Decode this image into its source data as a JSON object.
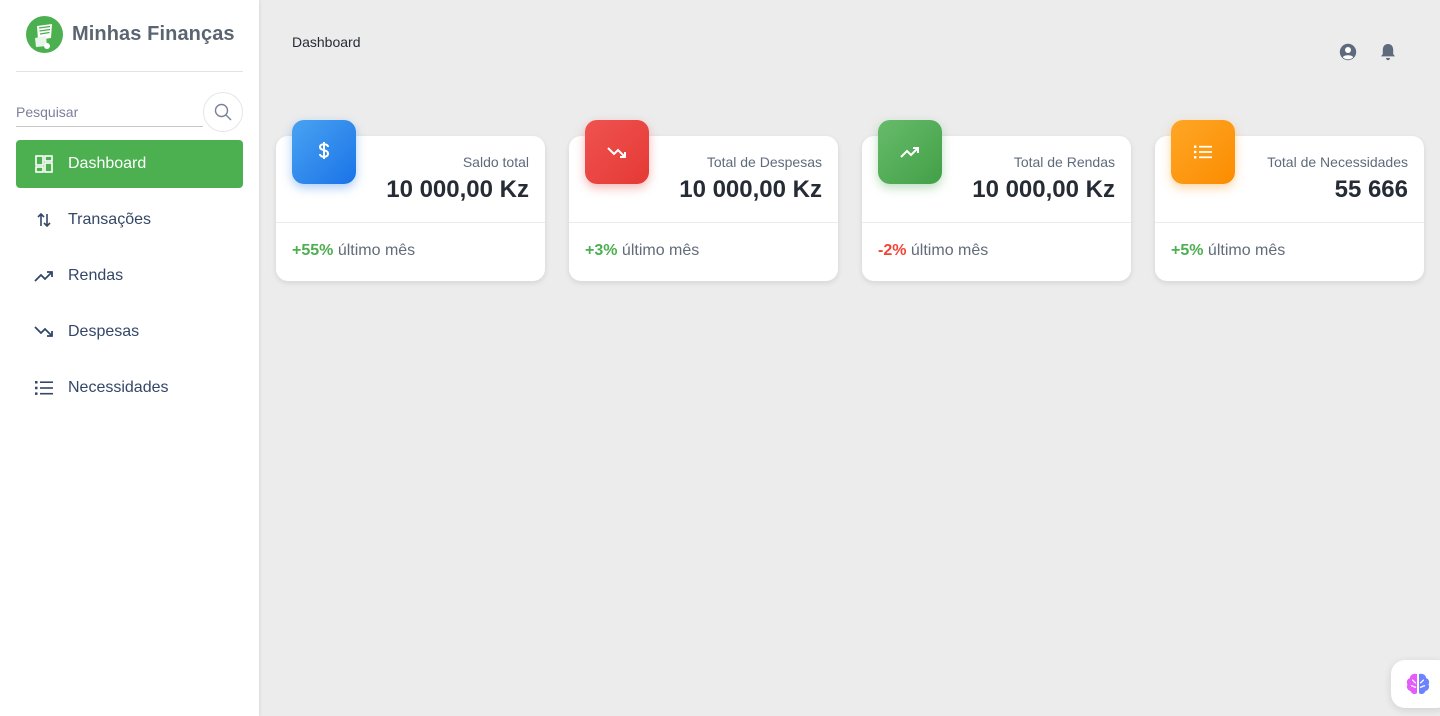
{
  "app": {
    "title": "Minhas Finanças"
  },
  "search": {
    "placeholder": "Pesquisar"
  },
  "nav": {
    "items": [
      {
        "label": "Dashboard",
        "icon": "dashboard-icon",
        "active": true
      },
      {
        "label": "Transações",
        "icon": "swap-vert-icon"
      },
      {
        "label": "Rendas",
        "icon": "trending-up-icon"
      },
      {
        "label": "Despesas",
        "icon": "trending-down-icon"
      },
      {
        "label": "Necessidades",
        "icon": "list-icon"
      }
    ]
  },
  "header": {
    "breadcrumb": "Dashboard",
    "icons": [
      "account-circle-icon",
      "bell-icon"
    ]
  },
  "cards": [
    {
      "label": "Saldo total",
      "value": "10 000,00 Kz",
      "delta": "+55%",
      "delta_text": "último mês",
      "icon": "dollar-icon",
      "color": "#2f86e8",
      "delta_color": "#4caf50"
    },
    {
      "label": "Total de Despesas",
      "value": "10 000,00 Kz",
      "delta": "+3%",
      "delta_text": "último mês",
      "icon": "trending-down-icon",
      "color": "#e53935",
      "delta_color": "#4caf50"
    },
    {
      "label": "Total de Rendas",
      "value": "10 000,00 Kz",
      "delta": "-2%",
      "delta_text": "último mês",
      "icon": "trending-up-icon",
      "color": "#4caf50",
      "delta_color": "#f44335"
    },
    {
      "label": "Total de Necessidades",
      "value": "55 666",
      "delta": "+5%",
      "delta_text": "último mês",
      "icon": "list-icon",
      "color": "#fb8c00",
      "delta_color": "#4caf50"
    }
  ],
  "colors": {
    "primary": "#4caf50",
    "danger": "#f44335",
    "info": "#2f86e8",
    "warning": "#fb8c00"
  }
}
